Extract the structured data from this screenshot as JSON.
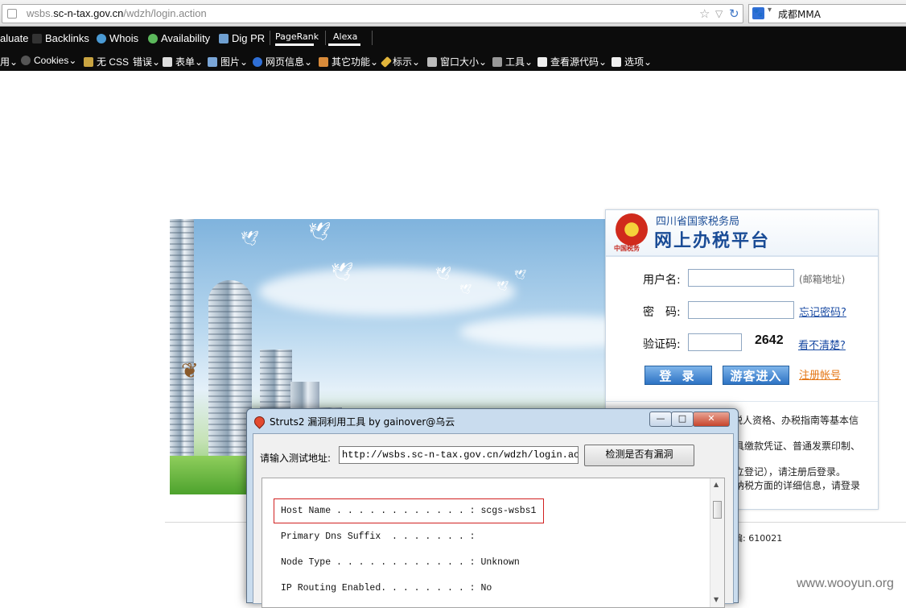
{
  "browser": {
    "url_plain_prefix": "wsbs.",
    "url_host": "sc-n-tax.gov.cn",
    "url_path": "/wdzh/login.action",
    "search_text": "成都MMA",
    "engine_icon_glyph": "🐾",
    "reload_glyph": "↻",
    "bookmark_glyph": "☆",
    "dropdown_glyph": "▽"
  },
  "seo_toolbar": {
    "items": [
      "aluate",
      "Backlinks",
      "Whois",
      "Availability",
      "Dig PR"
    ],
    "pagerank_label": "PageRank",
    "alexa_label": "Alexa"
  },
  "dev_toolbar": {
    "items": [
      "用",
      "Cookies",
      "无 CSS",
      "错误",
      "表单",
      "图片",
      "网页信息",
      "其它功能",
      "标示",
      "窗口大小",
      "工具",
      "查看源代码",
      "选项"
    ]
  },
  "login": {
    "org": "四川省国家税务局",
    "platform": "网上办税平台",
    "emblem_caption": "中国税务",
    "username_label": "用户名:",
    "username_hint": "(邮箱地址)",
    "password_label": "密　码:",
    "forgot_link": "忘记密码?",
    "captcha_label": "验证码:",
    "captcha_value": "2642",
    "captcha_refresh": "看不清楚?",
    "login_button": "登 录",
    "guest_button": "游客进入",
    "register_link": "注册帐号",
    "notice_lines": [
      "税人资格、办税指南等基本信",
      "具缴款凭证、普通发票印制、",
      "立登记），请注册后登录。",
      "纳税方面的详细信息，请登录"
    ]
  },
  "footer": {
    "postcode": "编: 610021"
  },
  "dialog": {
    "title": "Struts2 漏洞利用工具 by gainover@乌云",
    "minimize_glyph": "—",
    "maximize_glyph": "□",
    "close_glyph": "✕",
    "url_label": "请输入测试地址:",
    "url_value": "http://wsbs.sc-n-tax.gov.cn/wdzh/login.action",
    "check_button": "检测是否有漏洞",
    "output_lines": [
      "Host Name . . . . . . . . . . . . : scgs-wsbs1",
      "Primary Dns Suffix  . . . . . . . :",
      "Node Type . . . . . . . . . . . . : Unknown",
      "IP Routing Enabled. . . . . . . . : No"
    ]
  },
  "watermark": "www.wooyun.org"
}
